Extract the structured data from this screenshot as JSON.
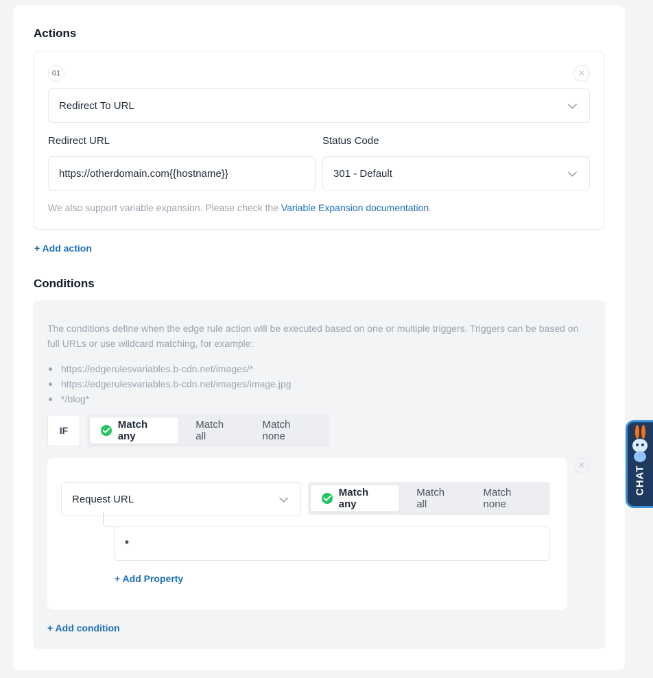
{
  "actions": {
    "title": "Actions",
    "step_number": "01",
    "action_type": "Redirect To URL",
    "redirect_url_label": "Redirect URL",
    "redirect_url_value": "https://otherdomain.com{{hostname}}",
    "status_code_label": "Status Code",
    "status_code_value": "301 - Default",
    "hint_prefix": "We also support variable expansion. Please check the ",
    "hint_link": "Variable Expansion documentation",
    "hint_suffix": ".",
    "add_action": "+ Add action"
  },
  "conditions": {
    "title": "Conditions",
    "description": "The conditions define when the edge rule action will be executed based on one or multiple triggers. Triggers can be based on full URLs or use wildcard matching, for example:",
    "examples": [
      "https://edgerulesvariables.b-cdn.net/images/*",
      "https://edgerulesvariables.b-cdn.net/images/image.jpg",
      "*/blog*"
    ],
    "if_label": "IF",
    "match_options": [
      "Match any",
      "Match all",
      "Match none"
    ],
    "match_selected": "Match any",
    "condition": {
      "property": "Request URL",
      "match_options": [
        "Match any",
        "Match all",
        "Match none"
      ],
      "match_selected": "Match any",
      "value": "*",
      "add_property": "+ Add Property"
    },
    "add_condition": "+ Add condition"
  },
  "chat": {
    "label": "CHAT"
  },
  "icons": {
    "close": "close-icon",
    "chevron": "chevron-down-icon",
    "check": "check-circle-icon",
    "mascot": "bunny-mascot-icon"
  },
  "colors": {
    "link": "#1d6fb8",
    "check": "#22c55e",
    "chat_bg": "#1f3a5f"
  }
}
